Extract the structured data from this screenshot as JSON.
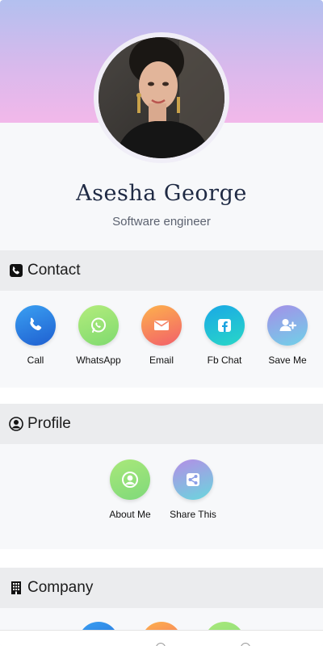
{
  "profile": {
    "name": "Asesha George",
    "title": "Software engineer"
  },
  "sections": {
    "contact": "Contact",
    "profile": "Profile",
    "company": "Company"
  },
  "contact_actions": [
    {
      "label": "Call",
      "icon": "phone-icon"
    },
    {
      "label": "WhatsApp",
      "icon": "whatsapp-icon"
    },
    {
      "label": "Email",
      "icon": "email-icon"
    },
    {
      "label": "Fb Chat",
      "icon": "facebook-icon"
    },
    {
      "label": "Save Me",
      "icon": "add-contact-icon"
    }
  ],
  "profile_actions": [
    {
      "label": "About Me",
      "icon": "user-icon"
    },
    {
      "label": "Share This",
      "icon": "share-icon"
    }
  ],
  "colors": {
    "header_top": "#b3c0ef",
    "header_bottom": "#f2b8ea",
    "section_bg": "#ebecee",
    "name_color": "#1f2a44"
  }
}
